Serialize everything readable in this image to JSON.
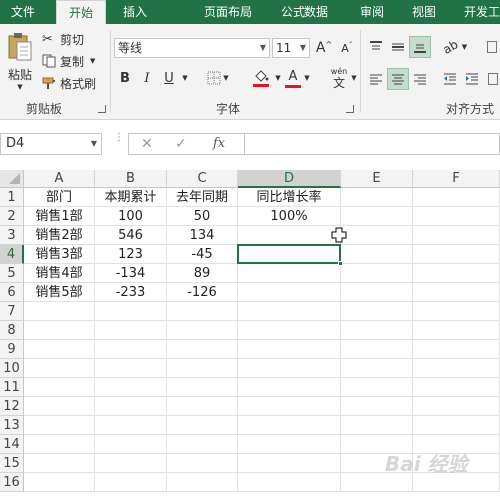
{
  "tabs": [
    {
      "label": "文件",
      "active": false
    },
    {
      "label": "开始",
      "active": true
    },
    {
      "label": "插入",
      "active": false
    },
    {
      "label": "页面布局",
      "active": false
    },
    {
      "label": "公式",
      "active": false
    },
    {
      "label": "数据",
      "active": false
    },
    {
      "label": "审阅",
      "active": false
    },
    {
      "label": "视图",
      "active": false
    },
    {
      "label": "开发工",
      "active": false
    }
  ],
  "clipboard": {
    "paste_label": "粘贴",
    "cut_label": "剪切",
    "copy_label": "复制",
    "format_painter_label": "格式刷",
    "group_label": "剪贴板"
  },
  "font": {
    "name": "等线",
    "size": "11",
    "bold": "B",
    "italic": "I",
    "underline": "U",
    "grow": "A",
    "shrink": "A",
    "color_letter": "A",
    "wen_label": "wén",
    "wen_char": "文",
    "group_label": "字体",
    "fill_color": "#e81123",
    "font_color": "#e81123"
  },
  "alignment": {
    "group_label": "对齐方式"
  },
  "formula_bar": {
    "name_box": "D4",
    "fx_label": "fx",
    "formula": ""
  },
  "columns": [
    "A",
    "B",
    "C",
    "D",
    "E",
    "F"
  ],
  "rows": [
    "1",
    "2",
    "3",
    "4",
    "5",
    "6",
    "7",
    "8",
    "9",
    "10",
    "11",
    "12",
    "13",
    "14",
    "15",
    "16"
  ],
  "cells": {
    "A1": "部门",
    "B1": "本期累计",
    "C1": "去年同期",
    "D1": "同比增长率",
    "A2": "销售1部",
    "B2": "100",
    "C2": "50",
    "D2": "100%",
    "A3": "销售2部",
    "B3": "546",
    "C3": "134",
    "A4": "销售3部",
    "B4": "123",
    "C4": "-45",
    "A5": "销售4部",
    "B5": "-134",
    "C5": "89",
    "A6": "销售5部",
    "B6": "-233",
    "C6": "-126"
  },
  "selected_cell": "D4",
  "watermark": "Bai 经验",
  "accent": "#217346"
}
